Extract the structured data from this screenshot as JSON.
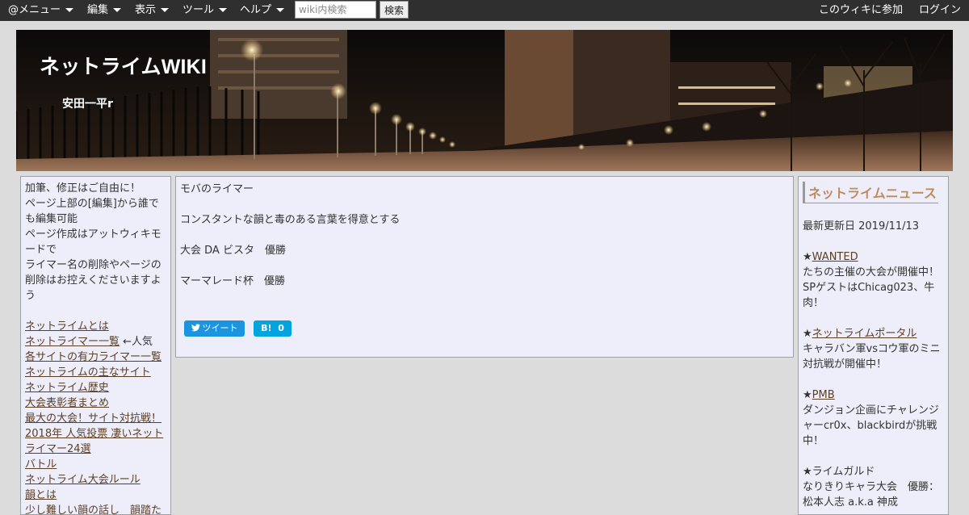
{
  "topbar": {
    "menu_label": "@メニュー",
    "edit_label": "編集",
    "view_label": "表示",
    "tools_label": "ツール",
    "help_label": "ヘルプ",
    "search_placeholder": "wiki内検索",
    "search_button": "検索",
    "join_label": "このウィキに参加",
    "login_label": "ログイン"
  },
  "banner": {
    "title": "ネットライムWIKI",
    "subtitle": "安田一平r"
  },
  "left_sidebar": {
    "intro_lines": [
      "加筆、修正はご自由に！",
      "ページ上部の[編集]から誰で",
      "も編集可能",
      "ページ作成はアットウィキモ",
      "ードで",
      "ライマー名の削除やページの",
      "削除はお控えくださいますよ",
      "う"
    ],
    "links": [
      "ネットライムとは",
      "ネットライマー一覧",
      "各サイトの有力ライマー一覧",
      "ネットライムの主なサイト",
      "ネットライム歴史",
      "大会表彰者まとめ",
      "最大の大会！サイト対抗戦！",
      "2018年 人気投票 凄いネット",
      "ライマー24選",
      "バトル",
      "ネットライム大会ルール",
      "韻とは",
      "少し難しい韻の話し　韻踏た"
    ],
    "popular_note": "←人気"
  },
  "main": {
    "lines": [
      "モバのライマー",
      "",
      "コンスタントな韻と毒のある言葉を得意とする",
      "",
      "大会 DA ビスタ　優勝",
      "",
      "マーマレード杯　優勝"
    ],
    "tweet_label": "ツイート",
    "hatena_label": "B!",
    "hatena_count": "0"
  },
  "right_sidebar": {
    "heading": "ネットライムニュース",
    "updated": "最新更新日 2019/11/13",
    "news": [
      {
        "star": "★",
        "link": "WANTED",
        "lines": [
          "たちの主催の大会が開催中！",
          "SPゲストはChicag023、牛",
          "肉！"
        ]
      },
      {
        "star": "★",
        "link": "ネットライムポータル",
        "lines": [
          "キャラバン軍vsコウ軍のミニ",
          "対抗戦が開催中！"
        ]
      },
      {
        "star": "★",
        "link": "PMB",
        "lines": [
          "ダンジョン企画にチャレンジ",
          "ャーcr0x、blackbirdが挑戦",
          "中！"
        ]
      },
      {
        "star": "★",
        "text": "ライムガルド",
        "lines": [
          "なりきりキャラ大会　優勝：",
          "松本人志 a.k.a 神成"
        ]
      }
    ]
  },
  "colors": {
    "topbar_bg": "#2f2f2f",
    "panel_bg": "#eeeefb",
    "link": "#5b3f25",
    "news_heading": "#c08b5a",
    "tweet_blue": "#1b95e0",
    "hatena_blue": "#00a4de"
  }
}
